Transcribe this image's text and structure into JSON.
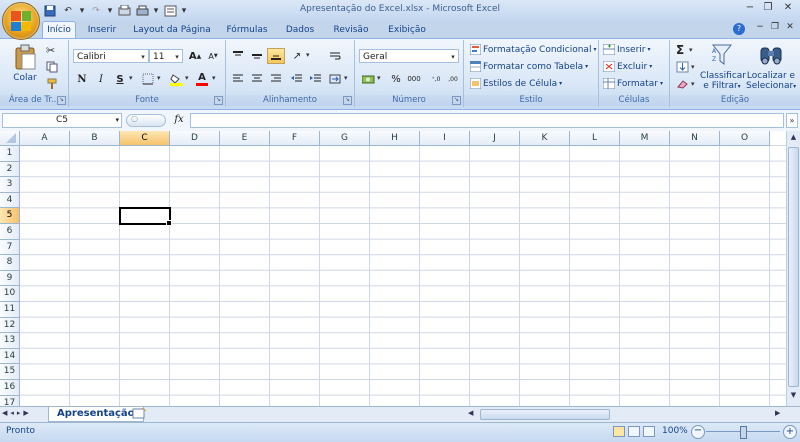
{
  "window": {
    "title": "Apresentação do Excel.xlsx - Microsoft Excel",
    "minimize_glyph": "−",
    "restore_glyph": "❐",
    "close_glyph": "✕"
  },
  "ribbon_tabs": [
    "Início",
    "Inserir",
    "Layout da Página",
    "Fórmulas",
    "Dados",
    "Revisão",
    "Exibição"
  ],
  "groups": {
    "clipboard": {
      "label": "Área de Tr...",
      "paste": "Colar"
    },
    "font": {
      "label": "Fonte",
      "font_name": "Calibri",
      "font_size": "11",
      "bold": "N",
      "italic": "I",
      "underline": "S",
      "grow": "A",
      "shrink": "A",
      "font_color_letter": "A"
    },
    "alignment": {
      "label": "Alinhamento"
    },
    "number": {
      "label": "Número",
      "format": "Geral",
      "percent": "%",
      "thousands": "000"
    },
    "styles": {
      "label": "Estilo",
      "conditional": "Formatação Condicional",
      "as_table": "Formatar como Tabela",
      "cell_styles": "Estilos de Célula"
    },
    "cells": {
      "label": "Células",
      "insert": "Inserir",
      "delete": "Excluir",
      "format": "Formatar"
    },
    "editing": {
      "label": "Edição",
      "sort": "Classificar",
      "sort2": "e Filtrar",
      "find": "Localizar e",
      "find2": "Selecionar",
      "sigma": "Σ"
    }
  },
  "formula_bar": {
    "name_box": "C5",
    "fx": "fx",
    "value": ""
  },
  "columns": [
    "A",
    "B",
    "C",
    "D",
    "E",
    "F",
    "G",
    "H",
    "I",
    "J",
    "K",
    "L",
    "M",
    "N",
    "O"
  ],
  "rows": [
    "1",
    "2",
    "3",
    "4",
    "5",
    "6",
    "7",
    "8",
    "9",
    "10",
    "11",
    "12",
    "13",
    "14",
    "15",
    "16",
    "17"
  ],
  "active_cell": {
    "column": "C",
    "row": "5"
  },
  "sheet_tabs": [
    "Apresentação"
  ],
  "status": {
    "mode": "Pronto",
    "zoom": "100%"
  },
  "colors": {
    "accent": "#15428b",
    "selected_header": "#f6c26b"
  }
}
